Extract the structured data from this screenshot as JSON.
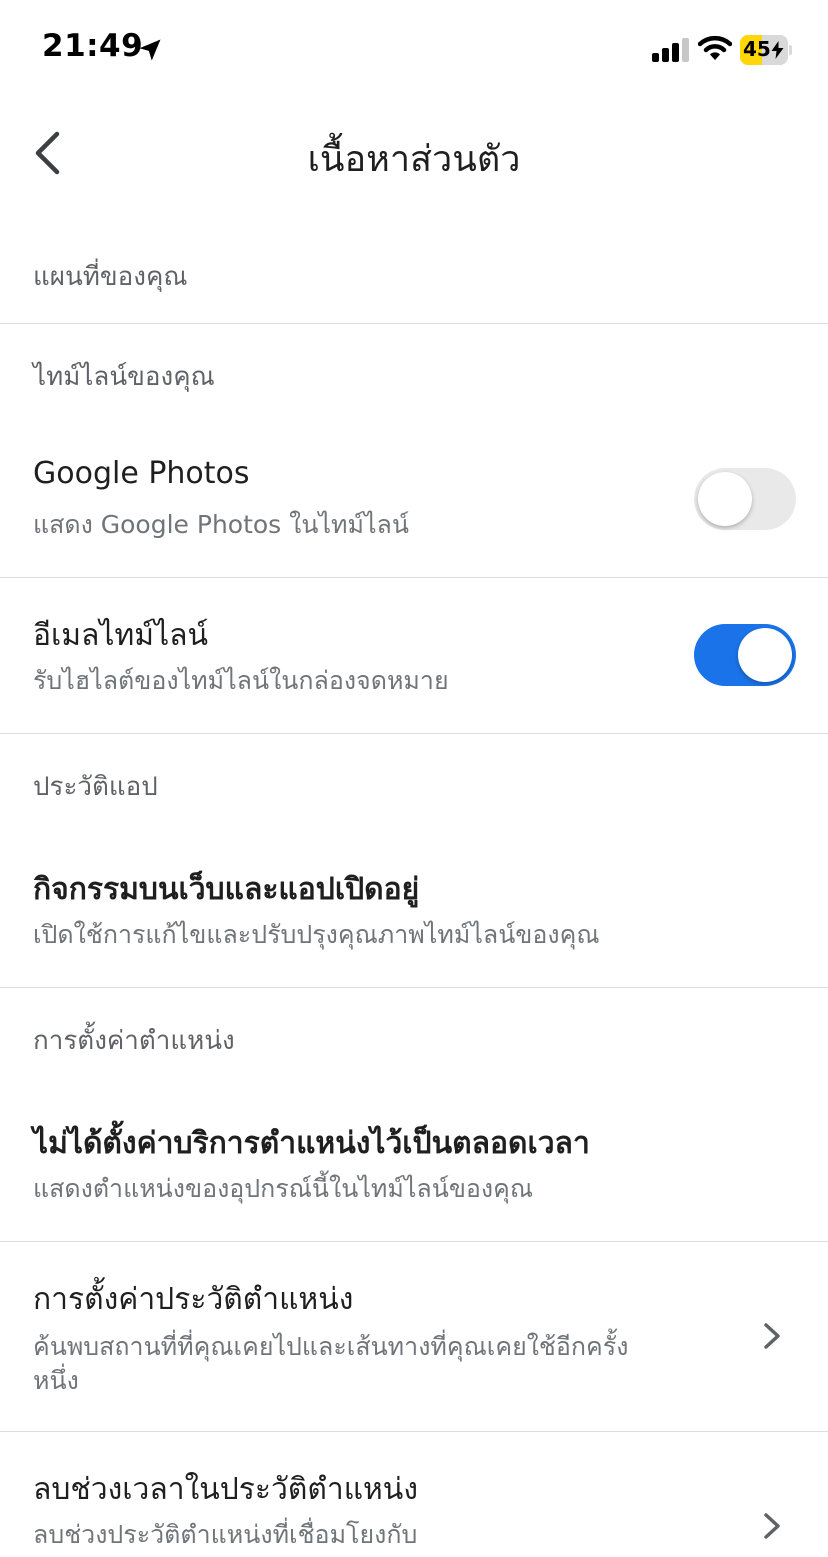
{
  "status_bar": {
    "time": "21:49",
    "battery_level": "45",
    "battery_fraction": 0.45
  },
  "header": {
    "title": "เนื้อหาส่วนตัว"
  },
  "sections": {
    "your_map": "แผนที่ของคุณ",
    "your_timeline": "ไทม์ไลน์ของคุณ",
    "app_history": "ประวัติแอป",
    "location_settings": "การตั้งค่าตำแหน่ง"
  },
  "items": {
    "google_photos": {
      "title": "Google Photos",
      "subtitle": "แสดง Google Photos ในไทม์ไลน์",
      "enabled": false
    },
    "timeline_email": {
      "title": "อีเมลไทม์ไลน์",
      "subtitle": "รับไฮไลต์ของไทม์ไลน์ในกล่องจดหมาย",
      "enabled": true
    },
    "web_app_activity": {
      "title": "กิจกรรมบนเว็บและแอปเปิดอยู่",
      "subtitle": "เปิดใช้การแก้ไขและปรับปรุงคุณภาพไทม์ไลน์ของคุณ"
    },
    "location_services": {
      "title": "ไม่ได้ตั้งค่าบริการตำแหน่งไว้เป็นตลอดเวลา",
      "subtitle": "แสดงตำแหน่งของอุปกรณ์นี้ในไทม์ไลน์ของคุณ"
    },
    "location_history_settings": {
      "title": "การตั้งค่าประวัติตำแหน่ง",
      "subtitle": "ค้นพบสถานที่ที่คุณเคยไปและเส้นทางที่คุณเคยใช้อีกครั้งหนึ่ง"
    },
    "delete_location_history_range": {
      "title": "ลบช่วงเวลาในประวัติตำแหน่ง",
      "subtitle": "ลบช่วงประวัติตำแหน่งที่เชื่อมโยงกับ"
    }
  },
  "colors": {
    "accent": "#1a73e8",
    "toggle_off": "#e9e9ea",
    "battery": "#ffd60a"
  },
  "icons": [
    "location-arrow-icon",
    "signal-icon",
    "wifi-icon",
    "battery-icon",
    "back-chevron-icon",
    "chevron-right-icon"
  ]
}
